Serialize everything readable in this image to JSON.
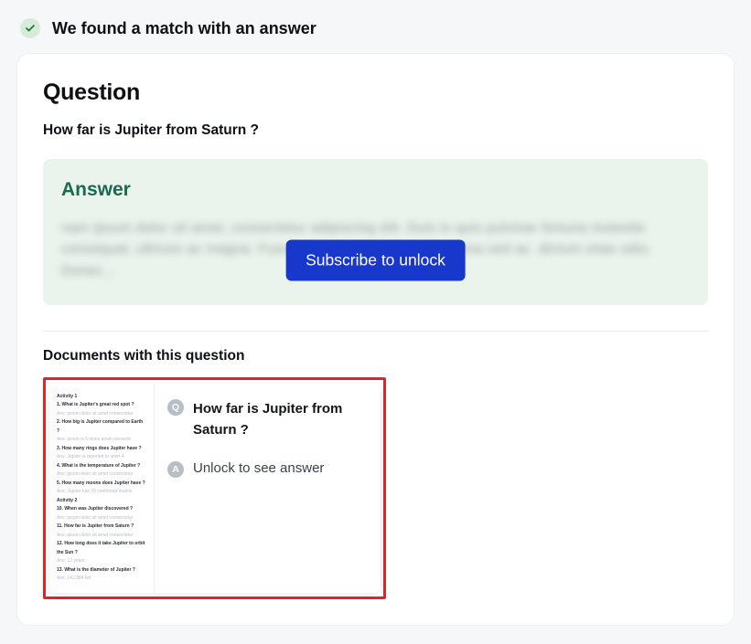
{
  "header": {
    "match_text": "We found a match with an answer"
  },
  "question": {
    "heading": "Question",
    "text": "How far is Jupiter from Saturn ?"
  },
  "answer": {
    "heading": "Answer",
    "blurred_placeholder": "nam ipsum dolor sit amet, consectetur adipiscing elit. Duis in quis pulvinar fortuna molestie consequat, ultrices ac magna. Fusce posuere, magna sed pulvina sed ac. dictum vitae odio. Donec…",
    "subscribe_label": "Subscribe to unlock"
  },
  "documents": {
    "heading": "Documents with this question",
    "items": [
      {
        "question_label": "Q",
        "question_text": "How far is Jupiter from Saturn ?",
        "answer_label": "A",
        "answer_text": "Unlock to see answer"
      }
    ]
  }
}
